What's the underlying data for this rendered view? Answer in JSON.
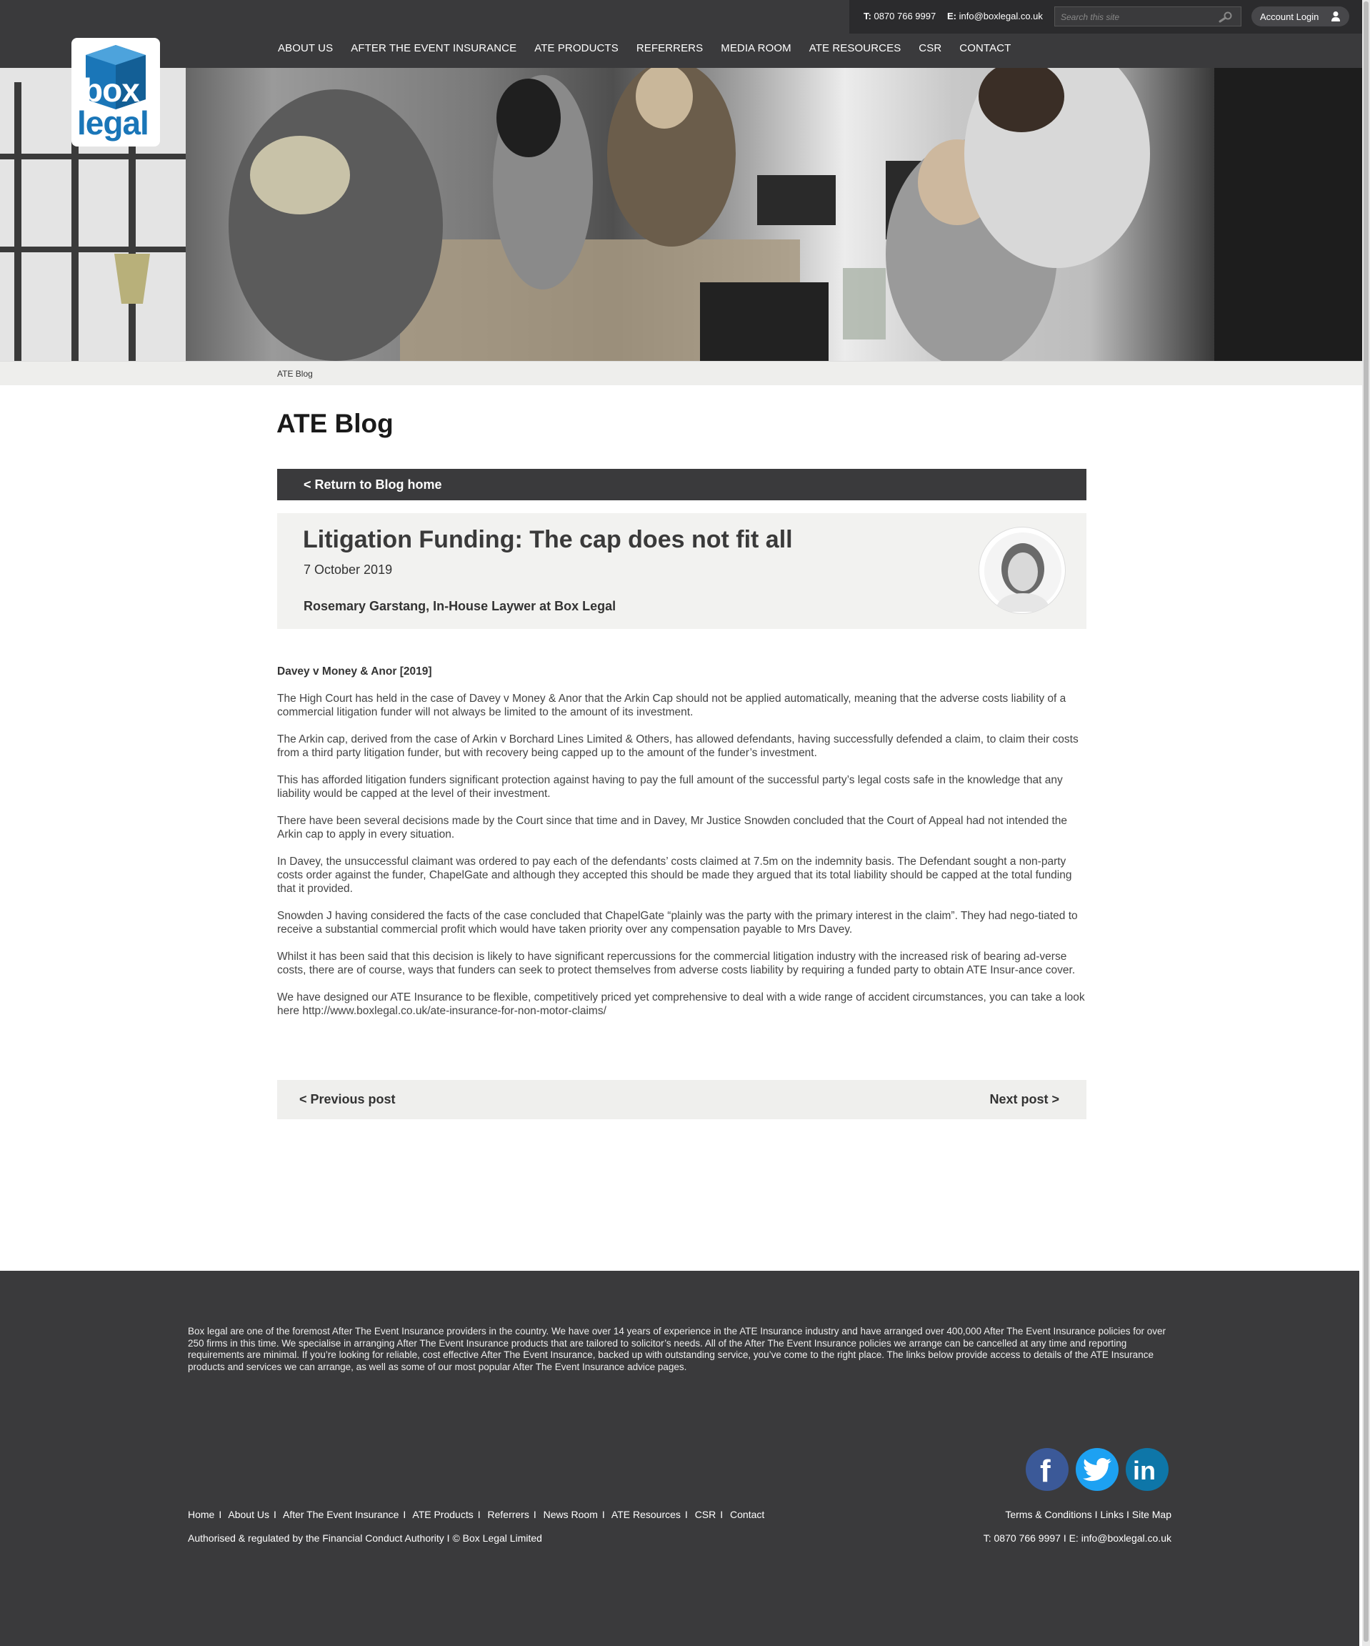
{
  "utility": {
    "phone_label": "T:",
    "phone": "0870 766 9997",
    "email_label": "E:",
    "email": "info@boxlegal.co.uk",
    "search_placeholder": "Search this site",
    "login_label": "Account Login"
  },
  "logo": {
    "word1": "box",
    "word2": "legal",
    "brand_color": "#1a76b8"
  },
  "nav": [
    "ABOUT US",
    "AFTER THE EVENT INSURANCE",
    "ATE PRODUCTS",
    "REFERRERS",
    "MEDIA ROOM",
    "ATE RESOURCES",
    "CSR",
    "CONTACT"
  ],
  "breadcrumb": "ATE Blog",
  "page_title": "ATE Blog",
  "return_link": "< Return to Blog home",
  "post": {
    "title": "Litigation Funding: The cap does not fit all",
    "date": "7 October 2019",
    "author": "Rosemary Garstang, In-House Laywer at Box Legal"
  },
  "article": {
    "heading": "Davey v Money & Anor [2019]",
    "paragraphs": [
      "The High Court has held in the case of Davey v Money & Anor that the Arkin Cap should not be applied automatically, meaning that the adverse costs liability of a commercial litigation funder will not always be limited to the amount of its investment.",
      "The Arkin cap, derived from the case of Arkin v Borchard Lines Limited & Others, has allowed defendants, having successfully defended a claim, to claim their costs from a third party litigation funder, but with recovery being capped up to the amount of the funder’s investment.",
      "This has afforded litigation funders significant protection against having to pay the full amount of the successful party’s legal costs safe in the knowledge that any liability would be capped at the level of their investment.",
      "There have been several decisions made by the Court since that time and in Davey, Mr Justice Snowden concluded that the Court of Appeal had not intended the Arkin cap to apply in every situation.",
      "In Davey, the unsuccessful claimant was ordered to pay each of the defendants’ costs claimed at 7.5m on the indemnity basis.  The Defendant sought a non-party costs order against the funder, ChapelGate and although they accepted this should be made they argued that its total liability should be capped at the total funding that it provided.",
      "Snowden J having considered the facts of the case concluded that ChapelGate “plainly was the party with the primary interest in the claim”.  They had nego-tiated to receive a substantial commercial profit which would have taken priority over any compensation payable to Mrs Davey.",
      "Whilst it has been said that this decision is likely to have significant repercussions for the commercial litigation industry with the increased risk of bearing ad-verse costs, there are of course, ways that funders can seek to protect themselves from adverse costs liability by requiring a funded party to obtain ATE Insur-ance cover.",
      "We have designed our ATE Insurance to be flexible, competitively priced yet comprehensive to deal with a wide range of accident circumstances, you can take a look here http://www.boxlegal.co.uk/ate-insurance-for-non-motor-claims/"
    ]
  },
  "post_nav": {
    "prev": "< Previous post",
    "next": "Next post >"
  },
  "footer": {
    "about": "Box legal are one of the foremost After The Event Insurance providers in the country. We have over 14 years of experience in the ATE Insurance industry and have arranged over 400,000 After The Event Insurance policies for over 250 firms in this time. We specialise in arranging After The Event Insurance products that are tailored to solicitor’s needs. All of the After The Event Insurance policies we arrange can be cancelled at any time and reporting requirements are minimal. If you’re looking for reliable, cost effective After The Event Insurance, backed up with outstanding service, you’ve come to the right place. The links below provide access to details of the ATE Insurance products and services we can arrange, as well as some of our most popular After The Event Insurance advice pages.",
    "social": {
      "facebook": "f",
      "linkedin": "in"
    },
    "links": [
      "Home",
      "About Us",
      "After The Event Insurance",
      "ATE Products",
      "Referrers",
      "News Room",
      "ATE Resources",
      "CSR",
      "Contact"
    ],
    "legal_links": [
      "Terms & Conditions",
      "Links",
      "Site Map"
    ],
    "regulation": "Authorised & regulated by the Financial Conduct Authority  I  © Box Legal Limited",
    "contact": "T: 0870 766 9997  I E: info@boxlegal.co.uk"
  }
}
